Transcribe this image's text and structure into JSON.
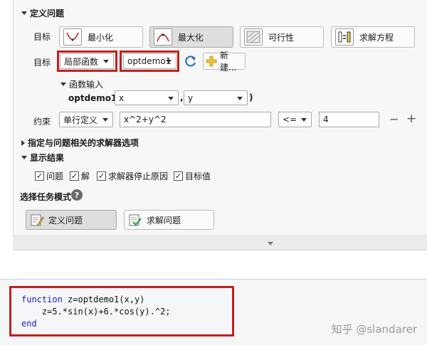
{
  "sections": {
    "define_problem": "定义问题",
    "solver_options": "指定与问题相关的求解器选项",
    "display_results": "显示结果",
    "task_mode": "选择任务模式"
  },
  "goal": {
    "label": "目标",
    "buttons": [
      {
        "label": "最小化",
        "icon": "minimize-curve-icon",
        "active": false
      },
      {
        "label": "最大化",
        "icon": "maximize-curve-icon",
        "active": true
      },
      {
        "label": "可行性",
        "icon": "feasibility-icon",
        "active": false
      },
      {
        "label": "求解方程",
        "icon": "solve-equation-icon",
        "active": false
      }
    ]
  },
  "objective": {
    "label": "目标",
    "type_value": "局部函数",
    "function_value": "optdemo1",
    "refresh_icon": "refresh-icon",
    "new_button": "新建...",
    "new_icon": "plus-icon"
  },
  "function_input": {
    "label": "函数输入",
    "signature_prefix": "optdemo1 (",
    "arg1": "x",
    "comma": ",",
    "arg2": "y",
    "close_paren": ")"
  },
  "constraint": {
    "label": "约束",
    "type_value": "单行定义",
    "expression": "x^2+y^2",
    "operator": "<=",
    "value": "4",
    "minus": "−",
    "plus": "+"
  },
  "display": {
    "checkboxes": [
      {
        "label": "问题",
        "checked": true
      },
      {
        "label": "解",
        "checked": true
      },
      {
        "label": "求解器停止原因",
        "checked": true
      },
      {
        "label": "目标值",
        "checked": true
      }
    ]
  },
  "task_mode": {
    "help_icon": "?",
    "define_button": "定义问题",
    "solve_button": "求解问题"
  },
  "code": {
    "line1_kw": "function",
    "line1_rest": " z=optdemo1(x,y)",
    "line2": "    z=5.*sin(x)+6.*cos(y).^2;",
    "line3_kw": "end"
  },
  "watermark": "知乎 @slandarer"
}
